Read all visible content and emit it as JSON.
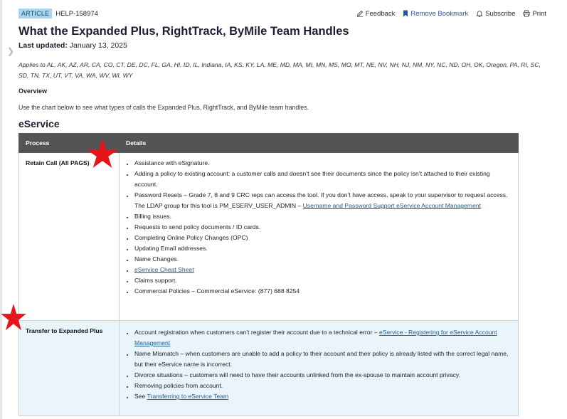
{
  "article": {
    "badge": "ARTICLE",
    "id": "HELP-158974",
    "title": "What the Expanded Plus, RightTrack, ByMile Team Handles",
    "last_updated_label": "Last updated:",
    "last_updated_date": "January 13, 2025",
    "applies_to": "Applies to AL, AK, AZ, AR, CA, CO, CT, DE, DC, FL, GA, HI, ID, IL, Indiana, IA, KS, KY, LA, ME, MD, MA, MI, MN, MS, MO, MT, NE, NV, NH, NJ, NM, NY, NC, ND, OH, OK, Oregon, PA, RI, SC, SD, TN, TX, UT, VT, VA, WA, WV, WI, WY",
    "overview_heading": "Overview",
    "overview_text": "Use the chart below to see what types of calls the Expanded Plus, RightTrack, and ByMile team handles.",
    "section_title": "eService"
  },
  "actions": [
    {
      "label": "Feedback",
      "icon": "edit-icon"
    },
    {
      "label": "Remove Bookmark",
      "icon": "bookmark-icon"
    },
    {
      "label": "Subscribe",
      "icon": "bell-icon"
    },
    {
      "label": "Print",
      "icon": "print-icon"
    }
  ],
  "colors": {
    "badge_bg": "#a9d6ec",
    "header_bg": "#545454",
    "row_highlight": "#eaf5fb",
    "link": "#1a5c8c",
    "star": "#e8141c"
  },
  "table": {
    "headers": [
      "Process",
      "Details"
    ],
    "rows": [
      {
        "process": "Retain Call (All PAGS)",
        "details": {
          "esignature": "Assistance with eSignature.",
          "adding_policy": "Adding a policy to existing account: a customer calls and doesn’t see their documents since the policy isn’t attached to their existing account.",
          "password_text": "Password Resets – Grade 7, 8 and 9 CRC reps can access the tool. If you don’t have access, speak to your supervisor to request access. The LDAP group for this tool is PM_ESERV_USER_ADMIN – ",
          "password_link": "Username and Password Support eService Account Management",
          "billing": "Billing issues.",
          "requests": "Requests to send policy documents / ID cards.",
          "opc": "Completing Online Policy Changes (OPC)",
          "email": "Updating Email addresses.",
          "name_changes": "Name Changes.",
          "cheat_sheet_link": "eService Cheat Sheet",
          "claims": "Claims support.",
          "commercial": "Commercial Policies – Commercial eService: (877) 688 8254"
        }
      },
      {
        "process": "Transfer to Expanded Plus",
        "details": {
          "registration_text": "Account registration when customers can’t register their account due to a technical error – ",
          "registration_link": "eService - Registering for eService Account Management",
          "name_mismatch": "Name Mismatch – when customers are unable to add a policy to their account and their policy is already listed with the correct legal name, but their eService name is incorrect.",
          "divorce": "Divorce situations – customers will need to have their accounts unlinked from the ex-spouse to maintain account privacy.",
          "removing": "Removing policies from account.",
          "see_prefix": "See ",
          "see_link": "Transferring to eService Team"
        }
      }
    ]
  }
}
